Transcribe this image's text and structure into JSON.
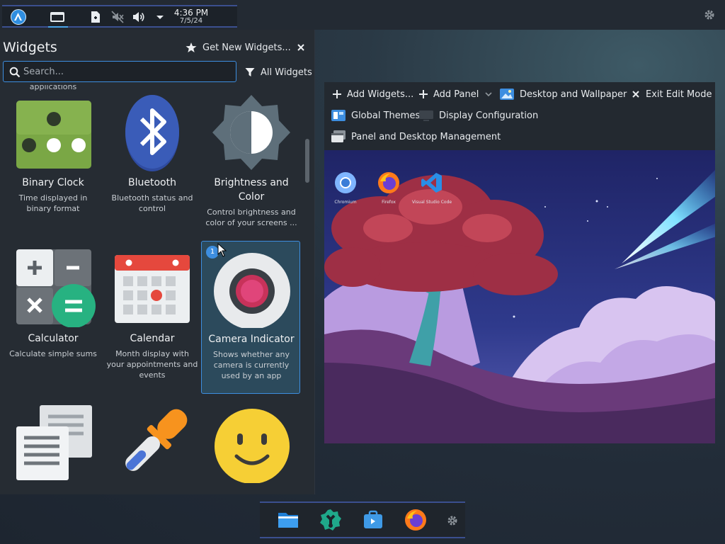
{
  "top_panel": {
    "time": "4:36 PM",
    "date": "7/5/24",
    "icons": [
      "app-launcher-icon",
      "task-manager-icon",
      "notes-icon",
      "mic-muted-icon",
      "volume-icon",
      "expand-tray-icon",
      "panel-settings-icon"
    ]
  },
  "widgets": {
    "title": "Widgets",
    "get_new": "Get New Widgets...",
    "search_placeholder": "Search...",
    "filter_label": "All Widgets",
    "partial_desc": "applications",
    "items": [
      {
        "name": "Binary Clock",
        "desc": "Time displayed in binary format",
        "icon": "binary-clock-icon"
      },
      {
        "name": "Bluetooth",
        "desc": "Bluetooth status and control",
        "icon": "bluetooth-icon"
      },
      {
        "name": "Brightness and Color",
        "desc": "Control brightness and color of your screens ...",
        "icon": "brightness-icon"
      },
      {
        "name": "Calculator",
        "desc": "Calculate simple sums",
        "icon": "calculator-icon"
      },
      {
        "name": "Calendar",
        "desc": "Month display with your appointments and events",
        "icon": "calendar-icon"
      },
      {
        "name": "Camera Indicator",
        "desc": "Shows whether any camera is currently used by an app",
        "icon": "camera-indicator-icon",
        "badge": "1"
      },
      {
        "name": "",
        "desc": "",
        "icon": "notes-widget-icon"
      },
      {
        "name": "",
        "desc": "",
        "icon": "color-picker-icon"
      },
      {
        "name": "",
        "desc": "",
        "icon": "smiley-icon"
      }
    ]
  },
  "edit_toolbar": {
    "add_widgets": "Add Widgets...",
    "add_panel": "Add Panel",
    "desktop_wallpaper": "Desktop and Wallpaper",
    "exit_edit": "Exit Edit Mode",
    "global_themes": "Global Themes",
    "display_config": "Display Configuration",
    "panel_desktop_mgmt": "Panel and Desktop Management"
  },
  "desktop_icons": [
    {
      "label": "Chromium",
      "icon": "chromium-icon"
    },
    {
      "label": "Firefox",
      "icon": "firefox-icon"
    },
    {
      "label": "Visual Studio Code",
      "icon": "vscode-icon"
    }
  ],
  "dock": {
    "icons": [
      "file-manager-icon",
      "system-settings-icon",
      "discover-store-icon",
      "firefox-icon",
      "dock-settings-icon"
    ]
  },
  "colors": {
    "accent": "#3d8ee0",
    "panel_bg": "#262c33",
    "selected_tile": "#2c4a5c"
  }
}
